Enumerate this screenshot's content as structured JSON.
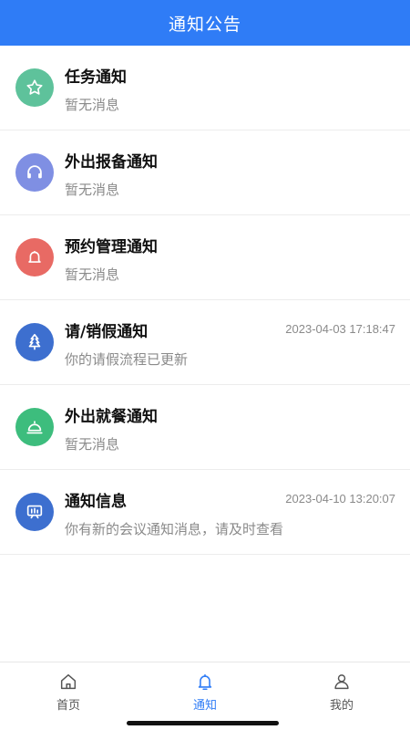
{
  "header": {
    "title": "通知公告"
  },
  "notifications": [
    {
      "title": "任务通知",
      "subtitle": "暂无消息",
      "time": "",
      "icon": "star-icon",
      "color": "#5ec29b"
    },
    {
      "title": "外出报备通知",
      "subtitle": "暂无消息",
      "time": "",
      "icon": "headset-icon",
      "color": "#7f8fe3"
    },
    {
      "title": "预约管理通知",
      "subtitle": "暂无消息",
      "time": "",
      "icon": "bell-icon",
      "color": "#e86a64"
    },
    {
      "title": "请/销假通知",
      "subtitle": "你的请假流程已更新",
      "time": "2023-04-03 17:18:47",
      "icon": "tree-icon",
      "color": "#3d6fcf"
    },
    {
      "title": "外出就餐通知",
      "subtitle": "暂无消息",
      "time": "",
      "icon": "food-cloche-icon",
      "color": "#3dbd7d"
    },
    {
      "title": "通知信息",
      "subtitle": "你有新的会议通知消息，请及时查看",
      "time": "2023-04-10 13:20:07",
      "icon": "message-board-icon",
      "color": "#3d6fcf"
    }
  ],
  "tabbar": {
    "items": [
      {
        "label": "首页",
        "icon": "home-icon"
      },
      {
        "label": "通知",
        "icon": "bell-icon",
        "active": true
      },
      {
        "label": "我的",
        "icon": "user-icon"
      }
    ],
    "active_color": "#2f7cf6"
  }
}
